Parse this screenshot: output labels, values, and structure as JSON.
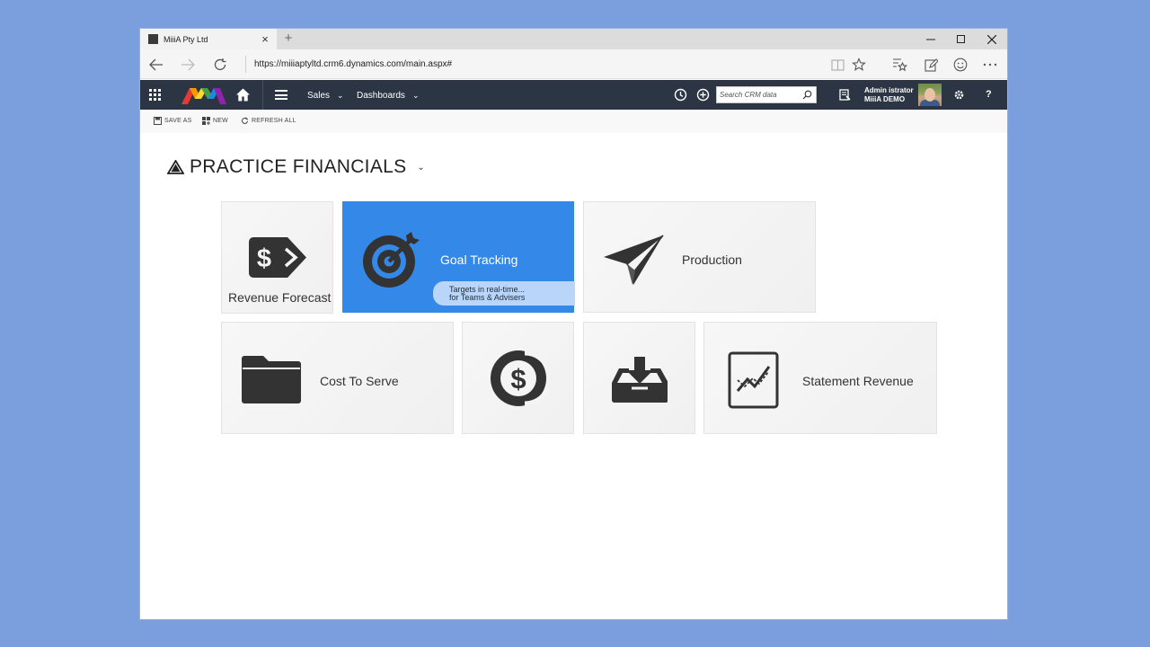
{
  "browser": {
    "tab_title": "MiiiA Pty Ltd",
    "url": "https://miiiaptyltd.crm6.dynamics.com/main.aspx#"
  },
  "crm_nav": {
    "sales": "Sales",
    "dashboards": "Dashboards",
    "search_placeholder": "Search CRM data",
    "user_name": "Admin istrator",
    "user_org": "MiiiA DEMO",
    "help": "?"
  },
  "commands": {
    "save_as": "SAVE AS",
    "new": "NEW",
    "refresh_all": "REFRESH ALL"
  },
  "page": {
    "title": "PRACTICE FINANCIALS"
  },
  "tiles": {
    "revenue_forecast": "Revenue Forecast",
    "goal_tracking": "Goal Tracking",
    "goal_callout_1": "Targets in real-time...",
    "goal_callout_2": "for Teams & Advisers",
    "production": "Production",
    "cost_to_serve": "Cost To Serve",
    "statement_revenue": "Statement Revenue"
  },
  "colors": {
    "nav_bg": "#2c3543",
    "tile_accent": "#3388e8",
    "page_bg": "#7b9fdd"
  }
}
